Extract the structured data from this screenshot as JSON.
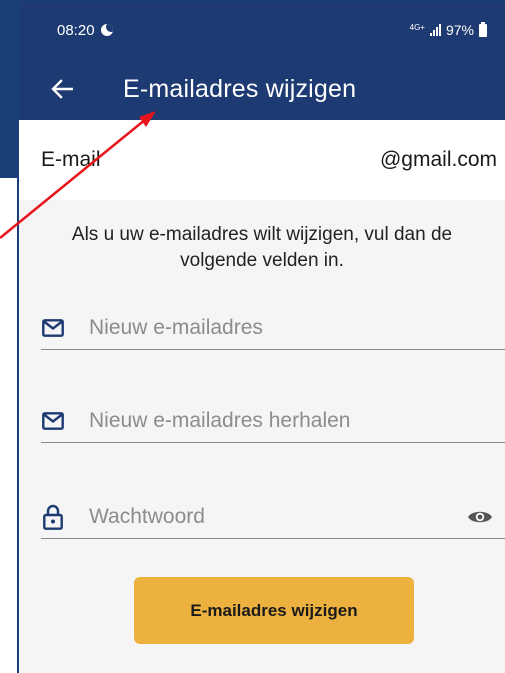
{
  "status_bar": {
    "time": "08:20",
    "network": "4G+",
    "battery": "97%"
  },
  "app_bar": {
    "title": "E-mailadres wijzigen"
  },
  "current_email": {
    "label": "E-mail",
    "value": "@gmail.com"
  },
  "info_text": "Als u uw e-mailadres wilt wijzigen, vul dan de volgende velden in.",
  "form": {
    "new_email_placeholder": "Nieuw e-mailadres",
    "repeat_email_placeholder": "Nieuw e-mailadres herhalen",
    "password_placeholder": "Wachtwoord",
    "submit_label": "E-mailadres wijzigen"
  },
  "colors": {
    "app_bar": "#1e3a72",
    "submit_button": "#ecb13f",
    "annotation_arrow": "#e8141b"
  },
  "icons": {
    "back": "arrow-left-icon",
    "email_fields": "envelope-icon",
    "password_field": "lock-icon",
    "password_toggle": "eye-icon"
  }
}
